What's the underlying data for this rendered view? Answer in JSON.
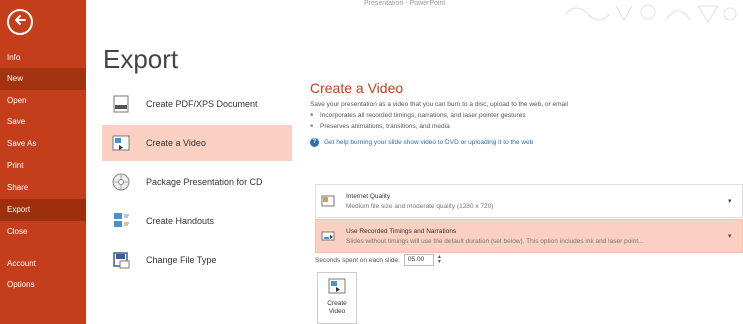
{
  "window": {
    "title": "Presentation - PowerPoint"
  },
  "nav": {
    "items": [
      {
        "id": "info",
        "label": "Info"
      },
      {
        "id": "new",
        "label": "New"
      },
      {
        "id": "open",
        "label": "Open"
      },
      {
        "id": "save",
        "label": "Save"
      },
      {
        "id": "save_as",
        "label": "Save As"
      },
      {
        "id": "print",
        "label": "Print"
      },
      {
        "id": "share",
        "label": "Share"
      },
      {
        "id": "export",
        "label": "Export"
      },
      {
        "id": "close",
        "label": "Close"
      },
      {
        "id": "account",
        "label": "Account"
      },
      {
        "id": "options",
        "label": "Options"
      }
    ],
    "active": "export"
  },
  "page": {
    "title": "Export"
  },
  "export_options": [
    {
      "id": "pdf",
      "label": "Create PDF/XPS Document",
      "icon": "pdf-document-icon"
    },
    {
      "id": "video",
      "label": "Create a Video",
      "icon": "video-icon"
    },
    {
      "id": "cd",
      "label": "Package Presentation for CD",
      "icon": "cd-icon"
    },
    {
      "id": "handouts",
      "label": "Create Handouts",
      "icon": "handouts-icon"
    },
    {
      "id": "filetype",
      "label": "Change File Type",
      "icon": "file-type-icon"
    }
  ],
  "detail": {
    "title": "Create a Video",
    "description": "Save your presentation as a video that you can burn to a disc, upload to the web, or email",
    "bullets": [
      "Incorporates all recorded timings, narrations, and laser pointer gestures",
      "Preserves animations, transitions, and media"
    ],
    "help_link": "Get help burning your slide show video to DVD or uploading it to the web",
    "quality": {
      "title": "Internet Quality",
      "subtitle": "Medium file size and moderate quality (1280 x 720)"
    },
    "timings": {
      "title": "Use Recorded Timings and Narrations",
      "subtitle": "Slides without timings will use the default duration (set below). This option includes ink and laser point..."
    },
    "seconds_label": "Seconds spent on each slide:",
    "seconds_value": "05.00",
    "create_button": {
      "line1": "Create",
      "line2": "Video"
    }
  },
  "colors": {
    "accent": "#c43e1c",
    "selected": "#f9d0c1",
    "link": "#2f6db0"
  }
}
